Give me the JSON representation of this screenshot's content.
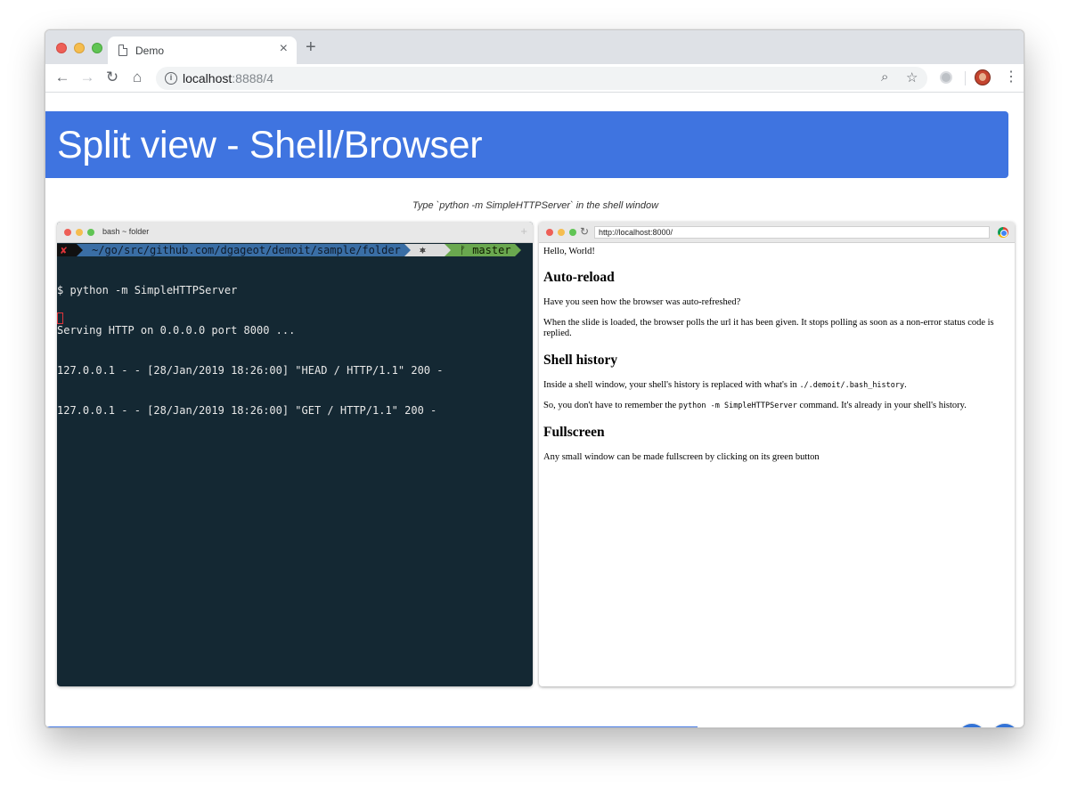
{
  "browser": {
    "tab_title": "Demo",
    "tab_close": "×",
    "new_tab": "+",
    "url_host": "localhost",
    "url_rest": ":8888/4",
    "info": "i"
  },
  "slide": {
    "title": "Split view - Shell/Browser",
    "subtitle": "Type `python -m SimpleHTTPServer` in the shell window"
  },
  "terminal": {
    "title": "bash ~ folder",
    "prompt_error": "✘",
    "prompt_path": "~/go/src/github.com/dgageot/demoit/sample/folder",
    "prompt_k8s": "⎈",
    "prompt_branch": "ᚠ master",
    "lines": [
      "$ python -m SimpleHTTPServer",
      "Serving HTTP on 0.0.0.0 port 8000 ...",
      "127.0.0.1 - - [28/Jan/2019 18:26:00] \"HEAD / HTTP/1.1\" 200 -",
      "127.0.0.1 - - [28/Jan/2019 18:26:00] \"GET / HTTP/1.1\" 200 -"
    ]
  },
  "mini_browser": {
    "url": "http://localhost:8000/",
    "hello": "Hello, World!",
    "h_autoreload": "Auto-reload",
    "p_autoreload_1": "Have you seen how the browser was auto-refreshed?",
    "p_autoreload_2": "When the slide is loaded, the browser polls the url it has been given. It stops polling as soon as a non-error status code is replied.",
    "h_history": "Shell history",
    "p_history_1a": "Inside a shell window, your shell's history is replaced with what's in ",
    "p_history_1code": "./.demoit/.bash_history",
    "p_history_1b": ".",
    "p_history_2a": "So, you don't have to remember the ",
    "p_history_2code": "python -m SimpleHTTPServer",
    "p_history_2b": " command. It's already in your shell's history.",
    "h_fullscreen": "Fullscreen",
    "p_fullscreen": "Any small window can be made fullscreen by clicking on its green button"
  },
  "nav": {
    "prev": "<",
    "next": ">"
  },
  "progress": 0.665,
  "colors": {
    "banner": "#3f74e0",
    "terminal_bg": "#142833",
    "nav_button": "#3373d6"
  }
}
